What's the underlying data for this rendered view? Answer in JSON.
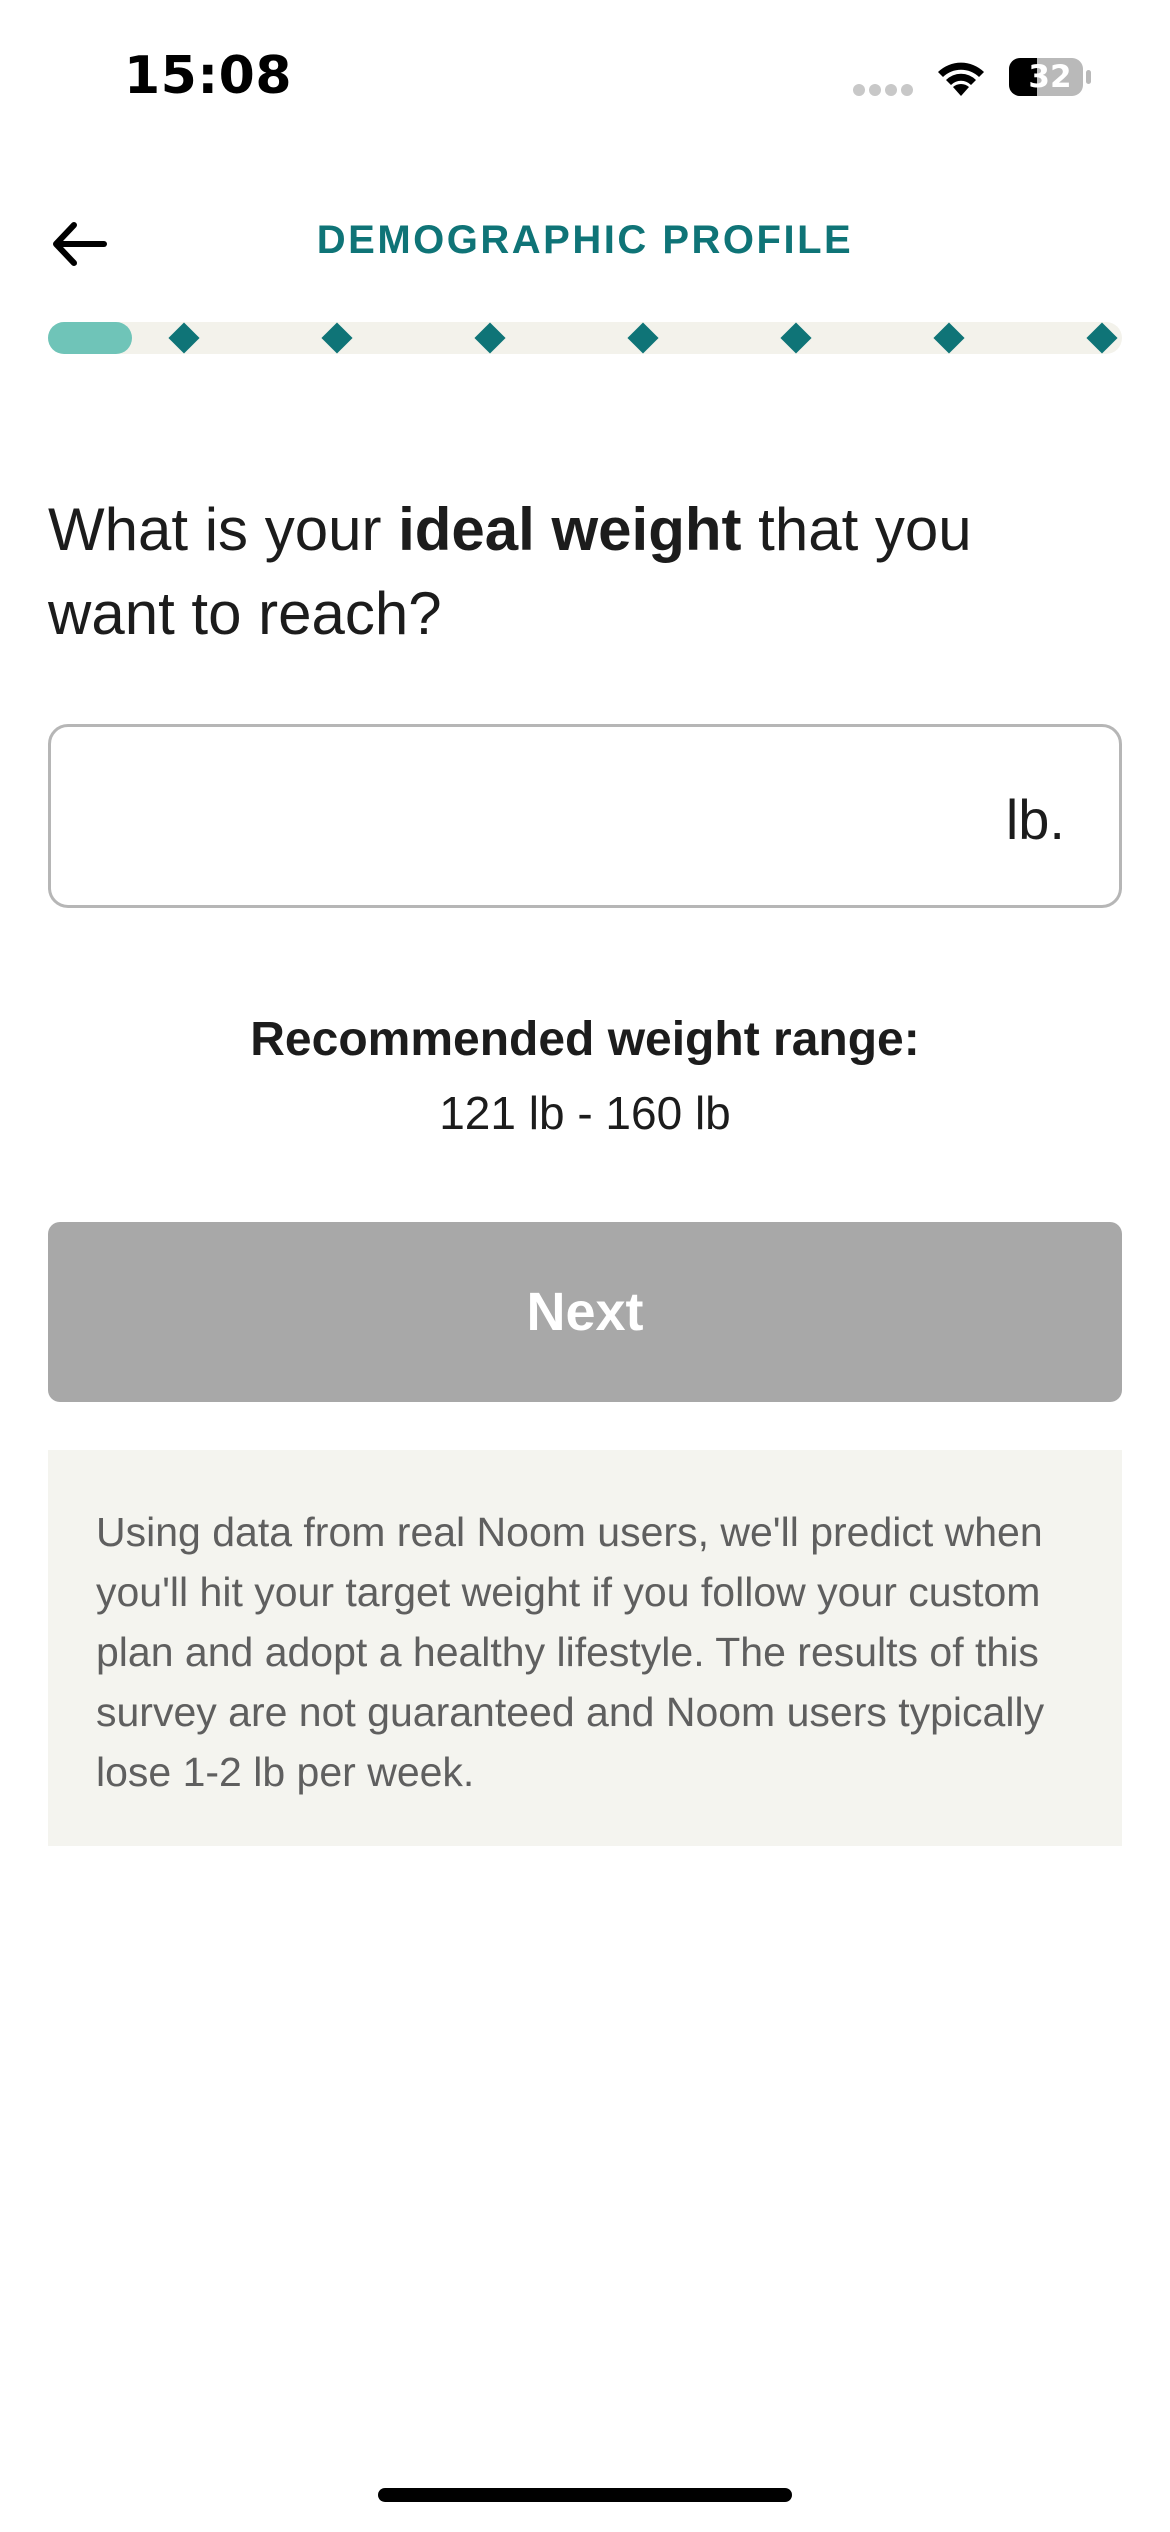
{
  "status_bar": {
    "time": "15:08",
    "battery": "32",
    "icons": [
      "cellular-signal-icon",
      "wifi-icon",
      "battery-icon"
    ]
  },
  "header": {
    "back_icon": "arrow-left-icon",
    "title": "DEMOGRAPHIC PROFILE"
  },
  "progress": {
    "current_step": 1,
    "total_steps": 8
  },
  "question": {
    "prefix": "What is your ",
    "emphasis": "ideal weight",
    "suffix": " that you want to reach?"
  },
  "weight_input": {
    "value": "",
    "placeholder": "",
    "unit": "lb."
  },
  "recommendation": {
    "title": "Recommended weight range:",
    "range": "121 lb - 160 lb"
  },
  "next_button": {
    "label": "Next",
    "enabled": false
  },
  "disclaimer": {
    "text": "Using data from real Noom users, we'll predict when you'll hit your target weight if you follow your custom plan and adopt a healthy lifestyle. The results of this survey are not guaranteed and Noom users typically lose 1-2 lb per week."
  },
  "colors": {
    "accent": "#0f7477",
    "progress_fill": "#6fc4b8",
    "progress_track": "#f3f2eb",
    "button_disabled": "#a8a8a8",
    "disclaimer_bg": "#f4f4ef"
  }
}
